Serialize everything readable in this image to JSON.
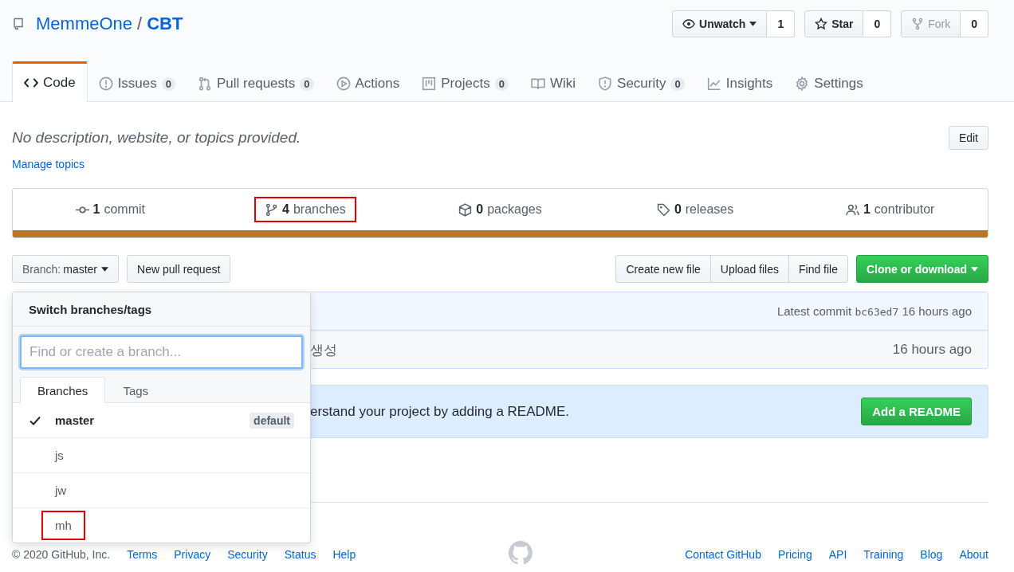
{
  "repo": {
    "owner": "MemmeOne",
    "separator": "/",
    "name": "CBT"
  },
  "actions": [
    {
      "kind": "watch",
      "label": "Unwatch",
      "count": "1",
      "disabled": false
    },
    {
      "kind": "star",
      "label": "Star",
      "count": "0",
      "disabled": false
    },
    {
      "kind": "fork",
      "label": "Fork",
      "count": "0",
      "disabled": true
    }
  ],
  "tabs": [
    {
      "kind": "code",
      "label": "Code",
      "selected": true
    },
    {
      "kind": "issues",
      "label": "Issues",
      "count": "0",
      "selected": false
    },
    {
      "kind": "pulls",
      "label": "Pull requests",
      "count": "0",
      "selected": false
    },
    {
      "kind": "actions",
      "label": "Actions",
      "selected": false
    },
    {
      "kind": "projects",
      "label": "Projects",
      "count": "0",
      "selected": false
    },
    {
      "kind": "wiki",
      "label": "Wiki",
      "selected": false
    },
    {
      "kind": "security",
      "label": "Security",
      "count": "0",
      "selected": false
    },
    {
      "kind": "insights",
      "label": "Insights",
      "selected": false
    },
    {
      "kind": "settings",
      "label": "Settings",
      "selected": false
    }
  ],
  "description": "No description, website, or topics provided.",
  "edit_button": "Edit",
  "manage_topics": "Manage topics",
  "stats": [
    {
      "kind": "commit",
      "count": "1",
      "label": "commit",
      "highlighted": false
    },
    {
      "kind": "branch",
      "count": "4",
      "label": "branches",
      "highlighted": true
    },
    {
      "kind": "package",
      "count": "0",
      "label": "packages",
      "highlighted": false
    },
    {
      "kind": "tag",
      "count": "0",
      "label": "releases",
      "highlighted": false
    },
    {
      "kind": "people",
      "count": "1",
      "label": "contributor",
      "highlighted": false
    }
  ],
  "branch_button": {
    "label": "Branch:",
    "value": "master"
  },
  "new_pull_request": "New pull request",
  "file_buttons": [
    "Create new file",
    "Upload files",
    "Find file"
  ],
  "clone_button": "Clone or download",
  "commit_bar": {
    "label": "Latest commit",
    "sha": "bc63ed7",
    "time": "16 hours ago"
  },
  "files": [
    {
      "message": "생성",
      "time": "16 hours ago"
    }
  ],
  "readme": {
    "text": "erstand your project by adding a README.",
    "button": "Add a README"
  },
  "branch_menu": {
    "title": "Switch branches/tags",
    "placeholder": "Find or create a branch...",
    "tabs": [
      {
        "label": "Branches",
        "selected": true
      },
      {
        "label": "Tags",
        "selected": false
      }
    ],
    "items": [
      {
        "name": "master",
        "checked": true,
        "badge": "default",
        "highlighted": false
      },
      {
        "name": "js",
        "checked": false,
        "highlighted": false
      },
      {
        "name": "jw",
        "checked": false,
        "highlighted": false
      },
      {
        "name": "mh",
        "checked": false,
        "highlighted": true
      }
    ]
  },
  "footer": {
    "copyright": "© 2020 GitHub, Inc.",
    "left_links": [
      "Terms",
      "Privacy",
      "Security",
      "Status",
      "Help"
    ],
    "right_links": [
      "Contact GitHub",
      "Pricing",
      "API",
      "Training",
      "Blog",
      "About"
    ]
  }
}
